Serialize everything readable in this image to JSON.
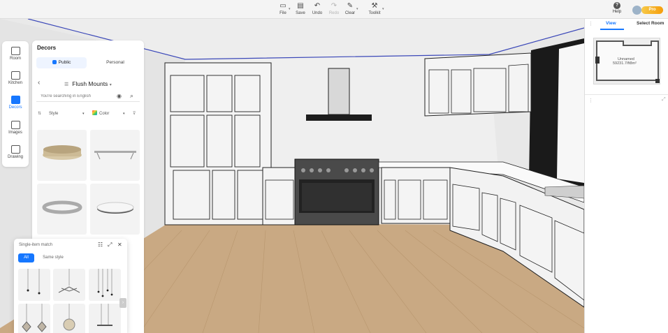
{
  "toolbar": {
    "file": "File",
    "save": "Save",
    "undo": "Undo",
    "redo": "Redo",
    "clear": "Clear",
    "toolkit": "Toolkit",
    "help": "Help",
    "pro": "Pro"
  },
  "icons": {
    "file": "▭",
    "save": "▤",
    "undo": "↶",
    "redo": "↷",
    "clear": "✎",
    "toolkit": "⚒",
    "help": "?",
    "back": "‹",
    "camera": "◉",
    "search": "⌕",
    "next": "›"
  },
  "nav": {
    "items": [
      {
        "label": "Room"
      },
      {
        "label": "Kitchen"
      },
      {
        "label": "Decors"
      },
      {
        "label": "Images"
      },
      {
        "label": "Drawing"
      }
    ]
  },
  "decors": {
    "title": "Decors",
    "tabs": [
      "Public",
      "Personal"
    ],
    "category": "Flush Mounts",
    "category_caret": "▾",
    "search_placeholder": "You're searching in English",
    "filters": {
      "style": "Style",
      "color": "Color"
    }
  },
  "match": {
    "title": "Single-item match",
    "tabs": [
      "All",
      "Same style"
    ]
  },
  "right_panel": {
    "tabs": [
      "View",
      "Select Room"
    ],
    "room_name": "Unnamed",
    "room_area": "59231.7/ft8m²"
  },
  "colors": {
    "accent": "#1677ff",
    "pro_badge": "#f5a524"
  }
}
